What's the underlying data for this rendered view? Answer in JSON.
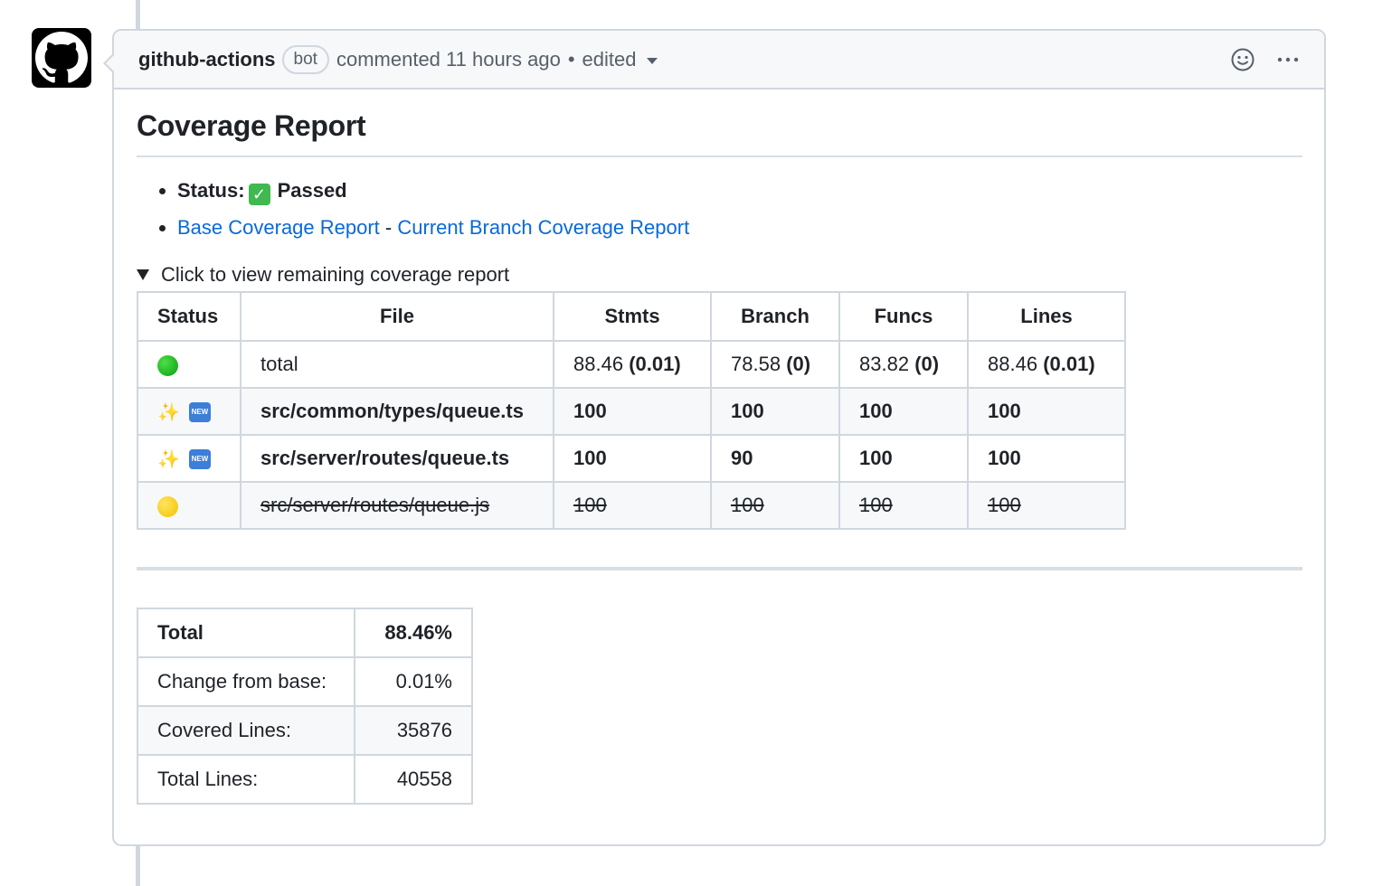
{
  "comment": {
    "author": "github-actions",
    "badge": "bot",
    "commented": "commented 11 hours ago",
    "separator": "•",
    "edited": "edited"
  },
  "report": {
    "title": "Coverage Report",
    "status_label": "Status:",
    "status_value": "Passed",
    "links": {
      "base": "Base Coverage Report",
      "separator": "-",
      "current": "Current Branch Coverage Report"
    },
    "details_summary": "Click to view remaining coverage report"
  },
  "coverage_table": {
    "headers": [
      "Status",
      "File",
      "Stmts",
      "Branch",
      "Funcs",
      "Lines"
    ],
    "rows": [
      {
        "status_icons": [
          "green-circle-icon"
        ],
        "file": "total",
        "stmts": "88.46",
        "stmts_delta": "(0.01)",
        "branch": "78.58",
        "branch_delta": "(0)",
        "funcs": "83.82",
        "funcs_delta": "(0)",
        "lines": "88.46",
        "lines_delta": "(0.01)"
      },
      {
        "status_icons": [
          "sparkles-icon",
          "new-icon"
        ],
        "file": "src/common/types/queue.ts",
        "stmts": "100",
        "branch": "100",
        "funcs": "100",
        "lines": "100"
      },
      {
        "status_icons": [
          "sparkles-icon",
          "new-icon"
        ],
        "file": "src/server/routes/queue.ts",
        "stmts": "100",
        "branch": "90",
        "funcs": "100",
        "lines": "100"
      },
      {
        "status_icons": [
          "yellow-circle-icon"
        ],
        "file": "src/server/routes/queue.js",
        "stmts": "100",
        "branch": "100",
        "funcs": "100",
        "lines": "100"
      }
    ]
  },
  "summary_table": {
    "rows": [
      {
        "label": "Total",
        "value": "88.46%"
      },
      {
        "label": "Change from base:",
        "value": "0.01%"
      },
      {
        "label": "Covered Lines:",
        "value": "35876"
      },
      {
        "label": "Total Lines:",
        "value": "40558"
      }
    ]
  },
  "icons": {
    "avatar": "github-mark-icon",
    "reactions": "smiley-icon",
    "more": "kebab-horizontal-icon",
    "status_check": "white-check-mark-icon"
  }
}
